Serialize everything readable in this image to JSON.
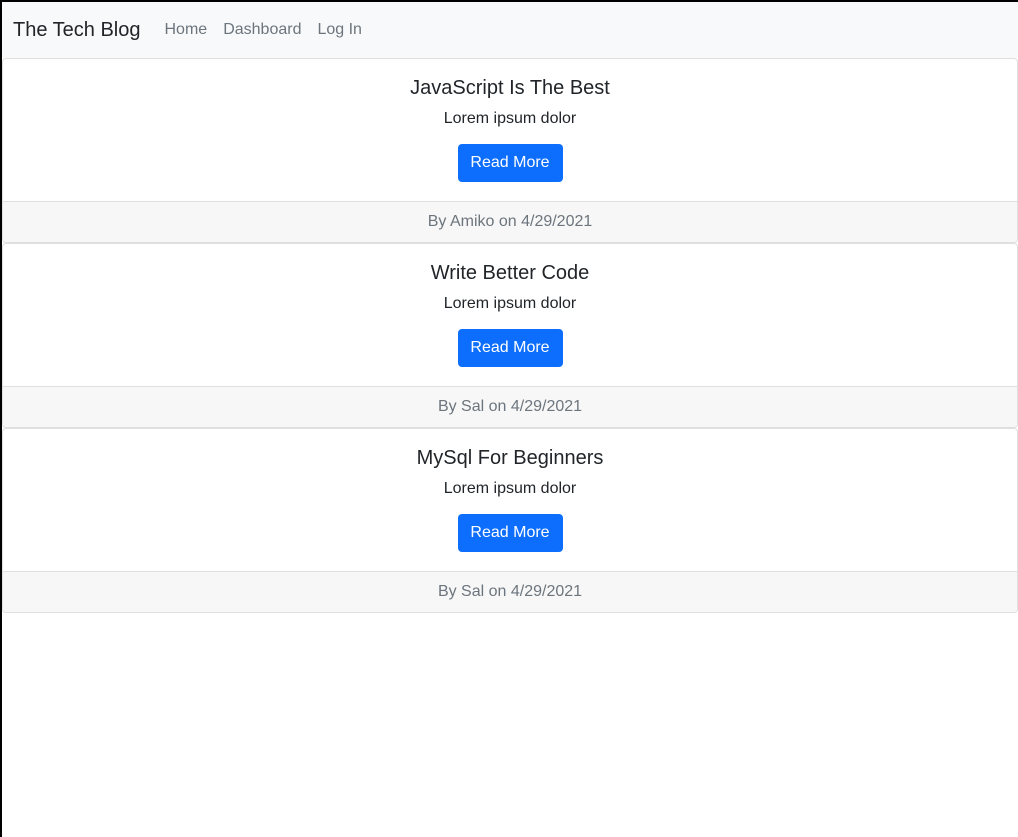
{
  "navbar": {
    "brand": "The Tech Blog",
    "links": [
      "Home",
      "Dashboard",
      "Log In"
    ]
  },
  "posts": [
    {
      "title": "JavaScript Is The Best",
      "excerpt": "Lorem ipsum dolor",
      "button_label": "Read More",
      "footer": "By Amiko on 4/29/2021"
    },
    {
      "title": "Write Better Code",
      "excerpt": "Lorem ipsum dolor",
      "button_label": "Read More",
      "footer": "By Sal on 4/29/2021"
    },
    {
      "title": "MySql For Beginners",
      "excerpt": "Lorem ipsum dolor",
      "button_label": "Read More",
      "footer": "By Sal on 4/29/2021"
    }
  ],
  "colors": {
    "primary": "#0d6efd",
    "navbar_bg": "#f8f9fa",
    "footer_bg": "#f7f7f7",
    "muted_text": "#6c757d"
  }
}
